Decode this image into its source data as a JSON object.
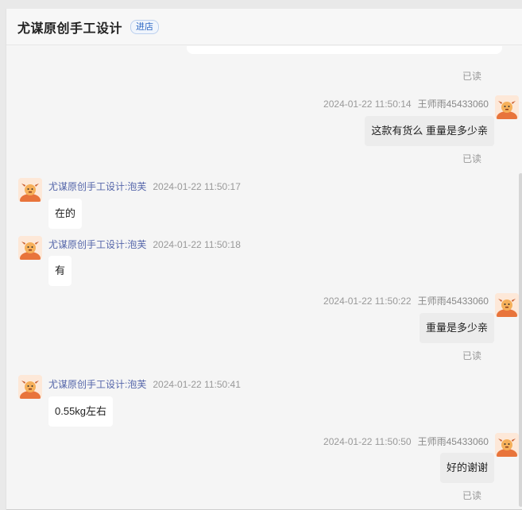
{
  "header": {
    "shop_name": "尤谋原创手工设计",
    "enter_shop_label": "进店"
  },
  "read_label": "已读",
  "messages": [
    {
      "direction": "out",
      "time": "2024-01-22 11:50:14",
      "sender": "王师雨45433060",
      "text": "这款有货么  重量是多少亲"
    },
    {
      "direction": "in",
      "time": "2024-01-22 11:50:17",
      "sender": "尤谋原创手工设计:泡芙",
      "text": "在的"
    },
    {
      "direction": "in",
      "time": "2024-01-22 11:50:18",
      "sender": "尤谋原创手工设计:泡芙",
      "text": "有"
    },
    {
      "direction": "out",
      "time": "2024-01-22 11:50:22",
      "sender": "王师雨45433060",
      "text": "重量是多少亲"
    },
    {
      "direction": "in",
      "time": "2024-01-22 11:50:41",
      "sender": "尤谋原创手工设计:泡芙",
      "text": "0.55kg左右"
    },
    {
      "direction": "out",
      "time": "2024-01-22 11:50:50",
      "sender": "王师雨45433060",
      "text": "好的谢谢"
    }
  ],
  "colors": {
    "accent_blue": "#2d68c4",
    "sender_in": "#5566aa",
    "avatar_orange": "#e8743b"
  },
  "icons": {
    "avatar": "cartoon-avatar-icon"
  }
}
